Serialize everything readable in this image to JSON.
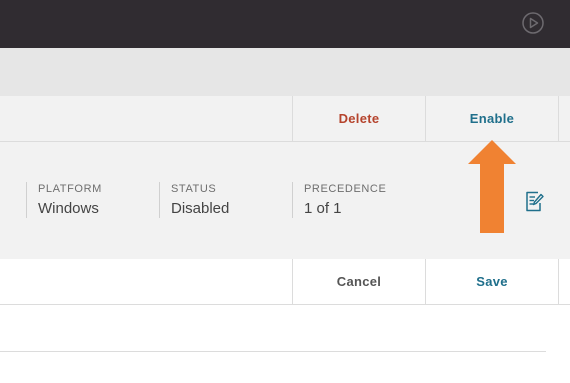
{
  "icons": {
    "play": "play-circle-icon",
    "edit": "edit-document-icon",
    "annotation": "up-arrow-icon"
  },
  "colors": {
    "topbar": "#302c31",
    "delete": "#b5442d",
    "accent": "#1f6f8b",
    "annotation_arrow": "#f08232"
  },
  "actions": {
    "delete_label": "Delete",
    "enable_label": "Enable"
  },
  "details": {
    "platform": {
      "label": "PLATFORM",
      "value": "Windows"
    },
    "status": {
      "label": "STATUS",
      "value": "Disabled"
    },
    "precedence": {
      "label": "PRECEDENCE",
      "value": "1 of 1"
    }
  },
  "form": {
    "cancel_label": "Cancel",
    "save_label": "Save"
  }
}
